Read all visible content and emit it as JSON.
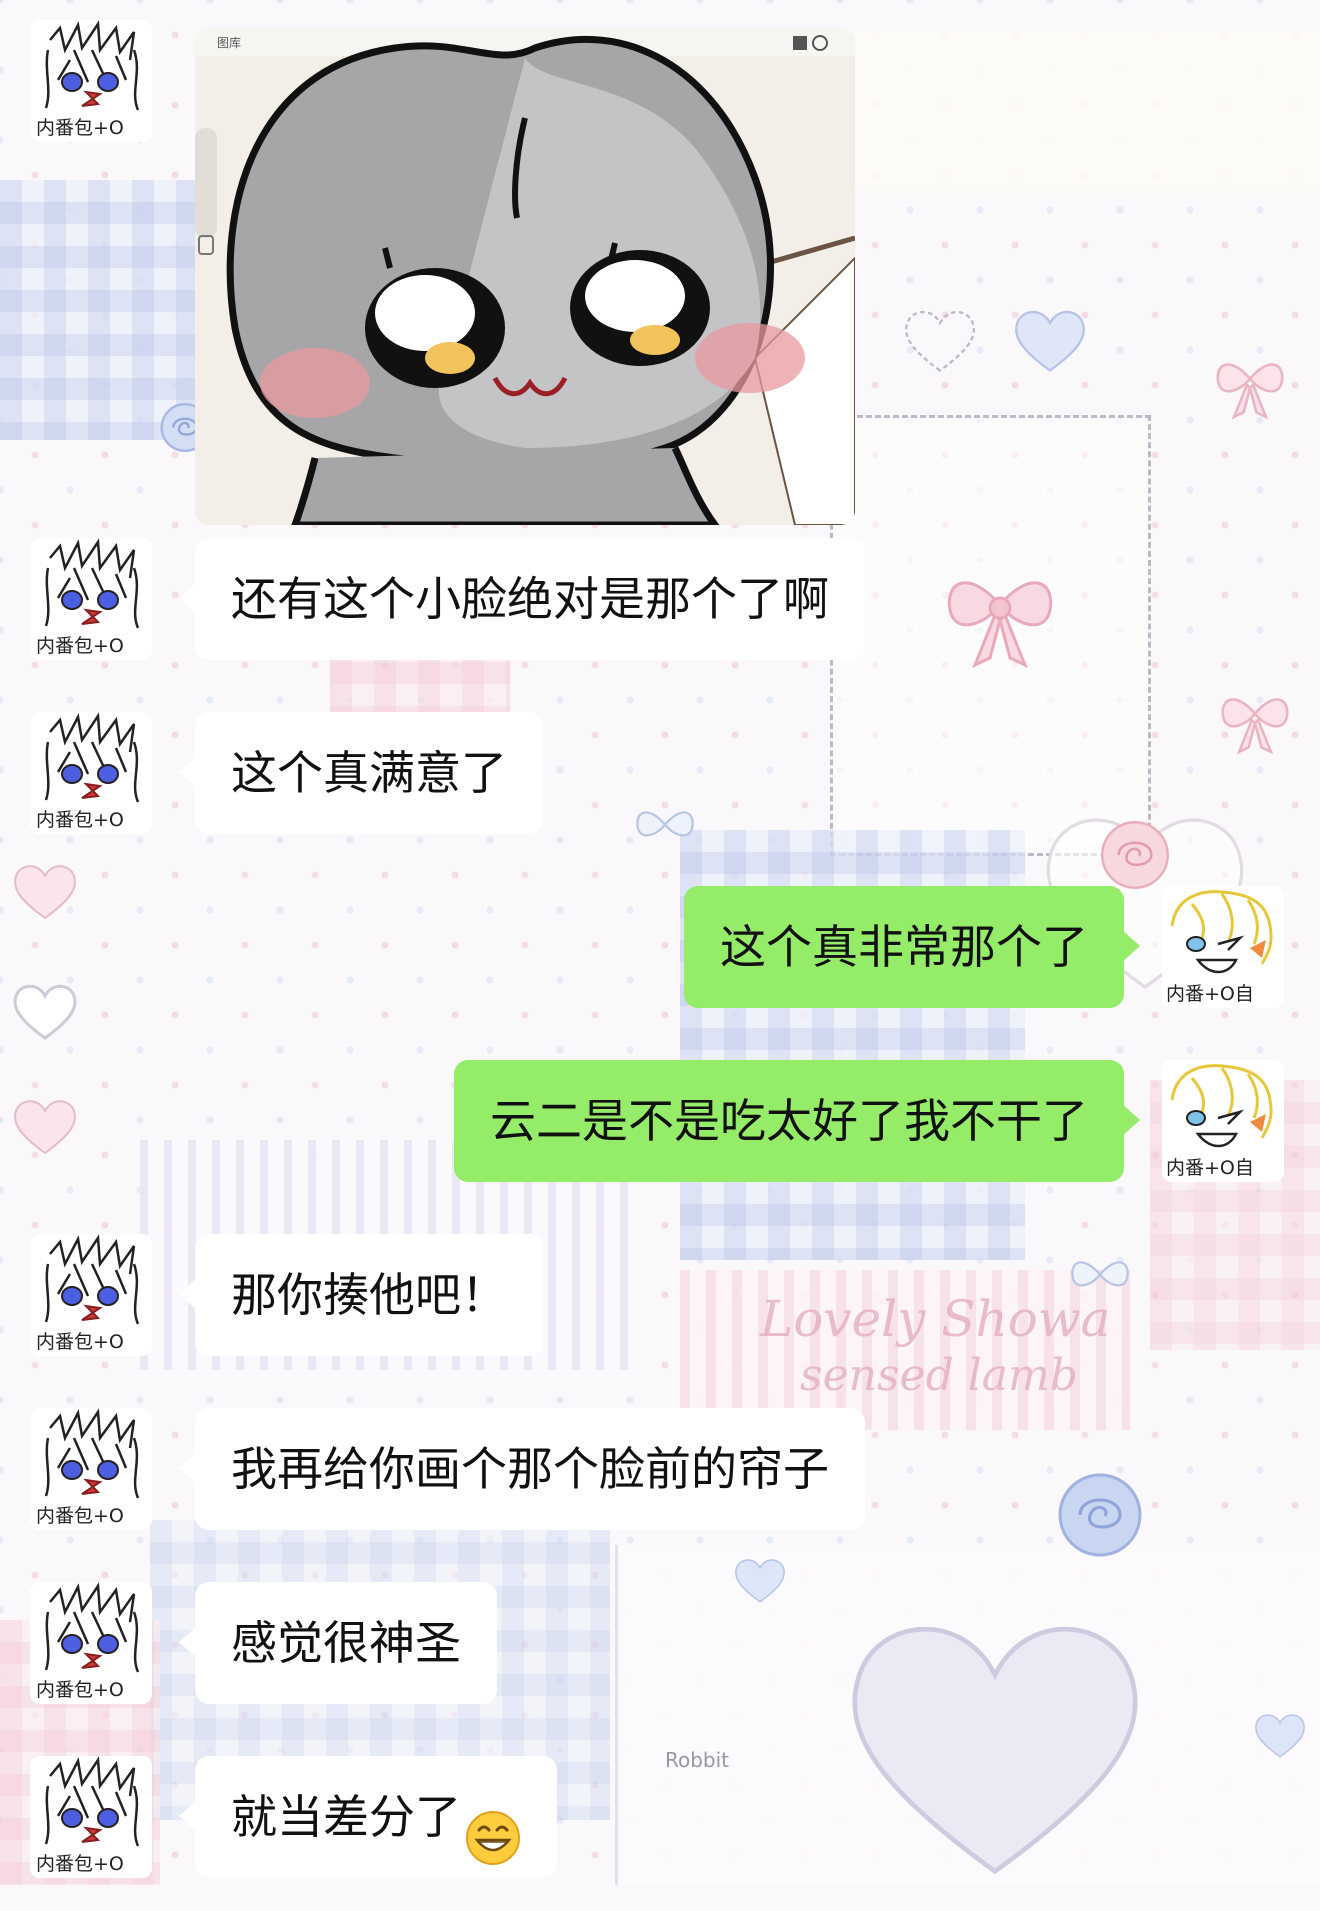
{
  "background": {
    "watermark_line1": "Lovely Showa",
    "watermark_line2": "sensed lamb",
    "small_label_robbit": "Robbit"
  },
  "image_message": {
    "app_toolbar_label": "图库"
  },
  "messages": [
    {
      "sender": "other",
      "type": "image"
    },
    {
      "sender": "other",
      "type": "text",
      "text": "还有这个小脸绝对是那个了啊"
    },
    {
      "sender": "other",
      "type": "text",
      "text": "这个真满意了"
    },
    {
      "sender": "self",
      "type": "text",
      "text": "这个真非常那个了"
    },
    {
      "sender": "self",
      "type": "text",
      "text": "云二是不是吃太好了我不干了"
    },
    {
      "sender": "other",
      "type": "text",
      "text": "那你揍他吧！"
    },
    {
      "sender": "other",
      "type": "text",
      "text": "我再给你画个那个脸前的帘子"
    },
    {
      "sender": "other",
      "type": "text",
      "text": "感觉很神圣"
    },
    {
      "sender": "other",
      "type": "text",
      "text": "就当差分了",
      "emoji": "grinning-face-emoji"
    }
  ],
  "avatars": {
    "other_signature": "内番包+O",
    "self_signature": "内番+O自"
  },
  "colors": {
    "incoming_bubble": "#ffffff",
    "outgoing_bubble": "#95ec69"
  }
}
